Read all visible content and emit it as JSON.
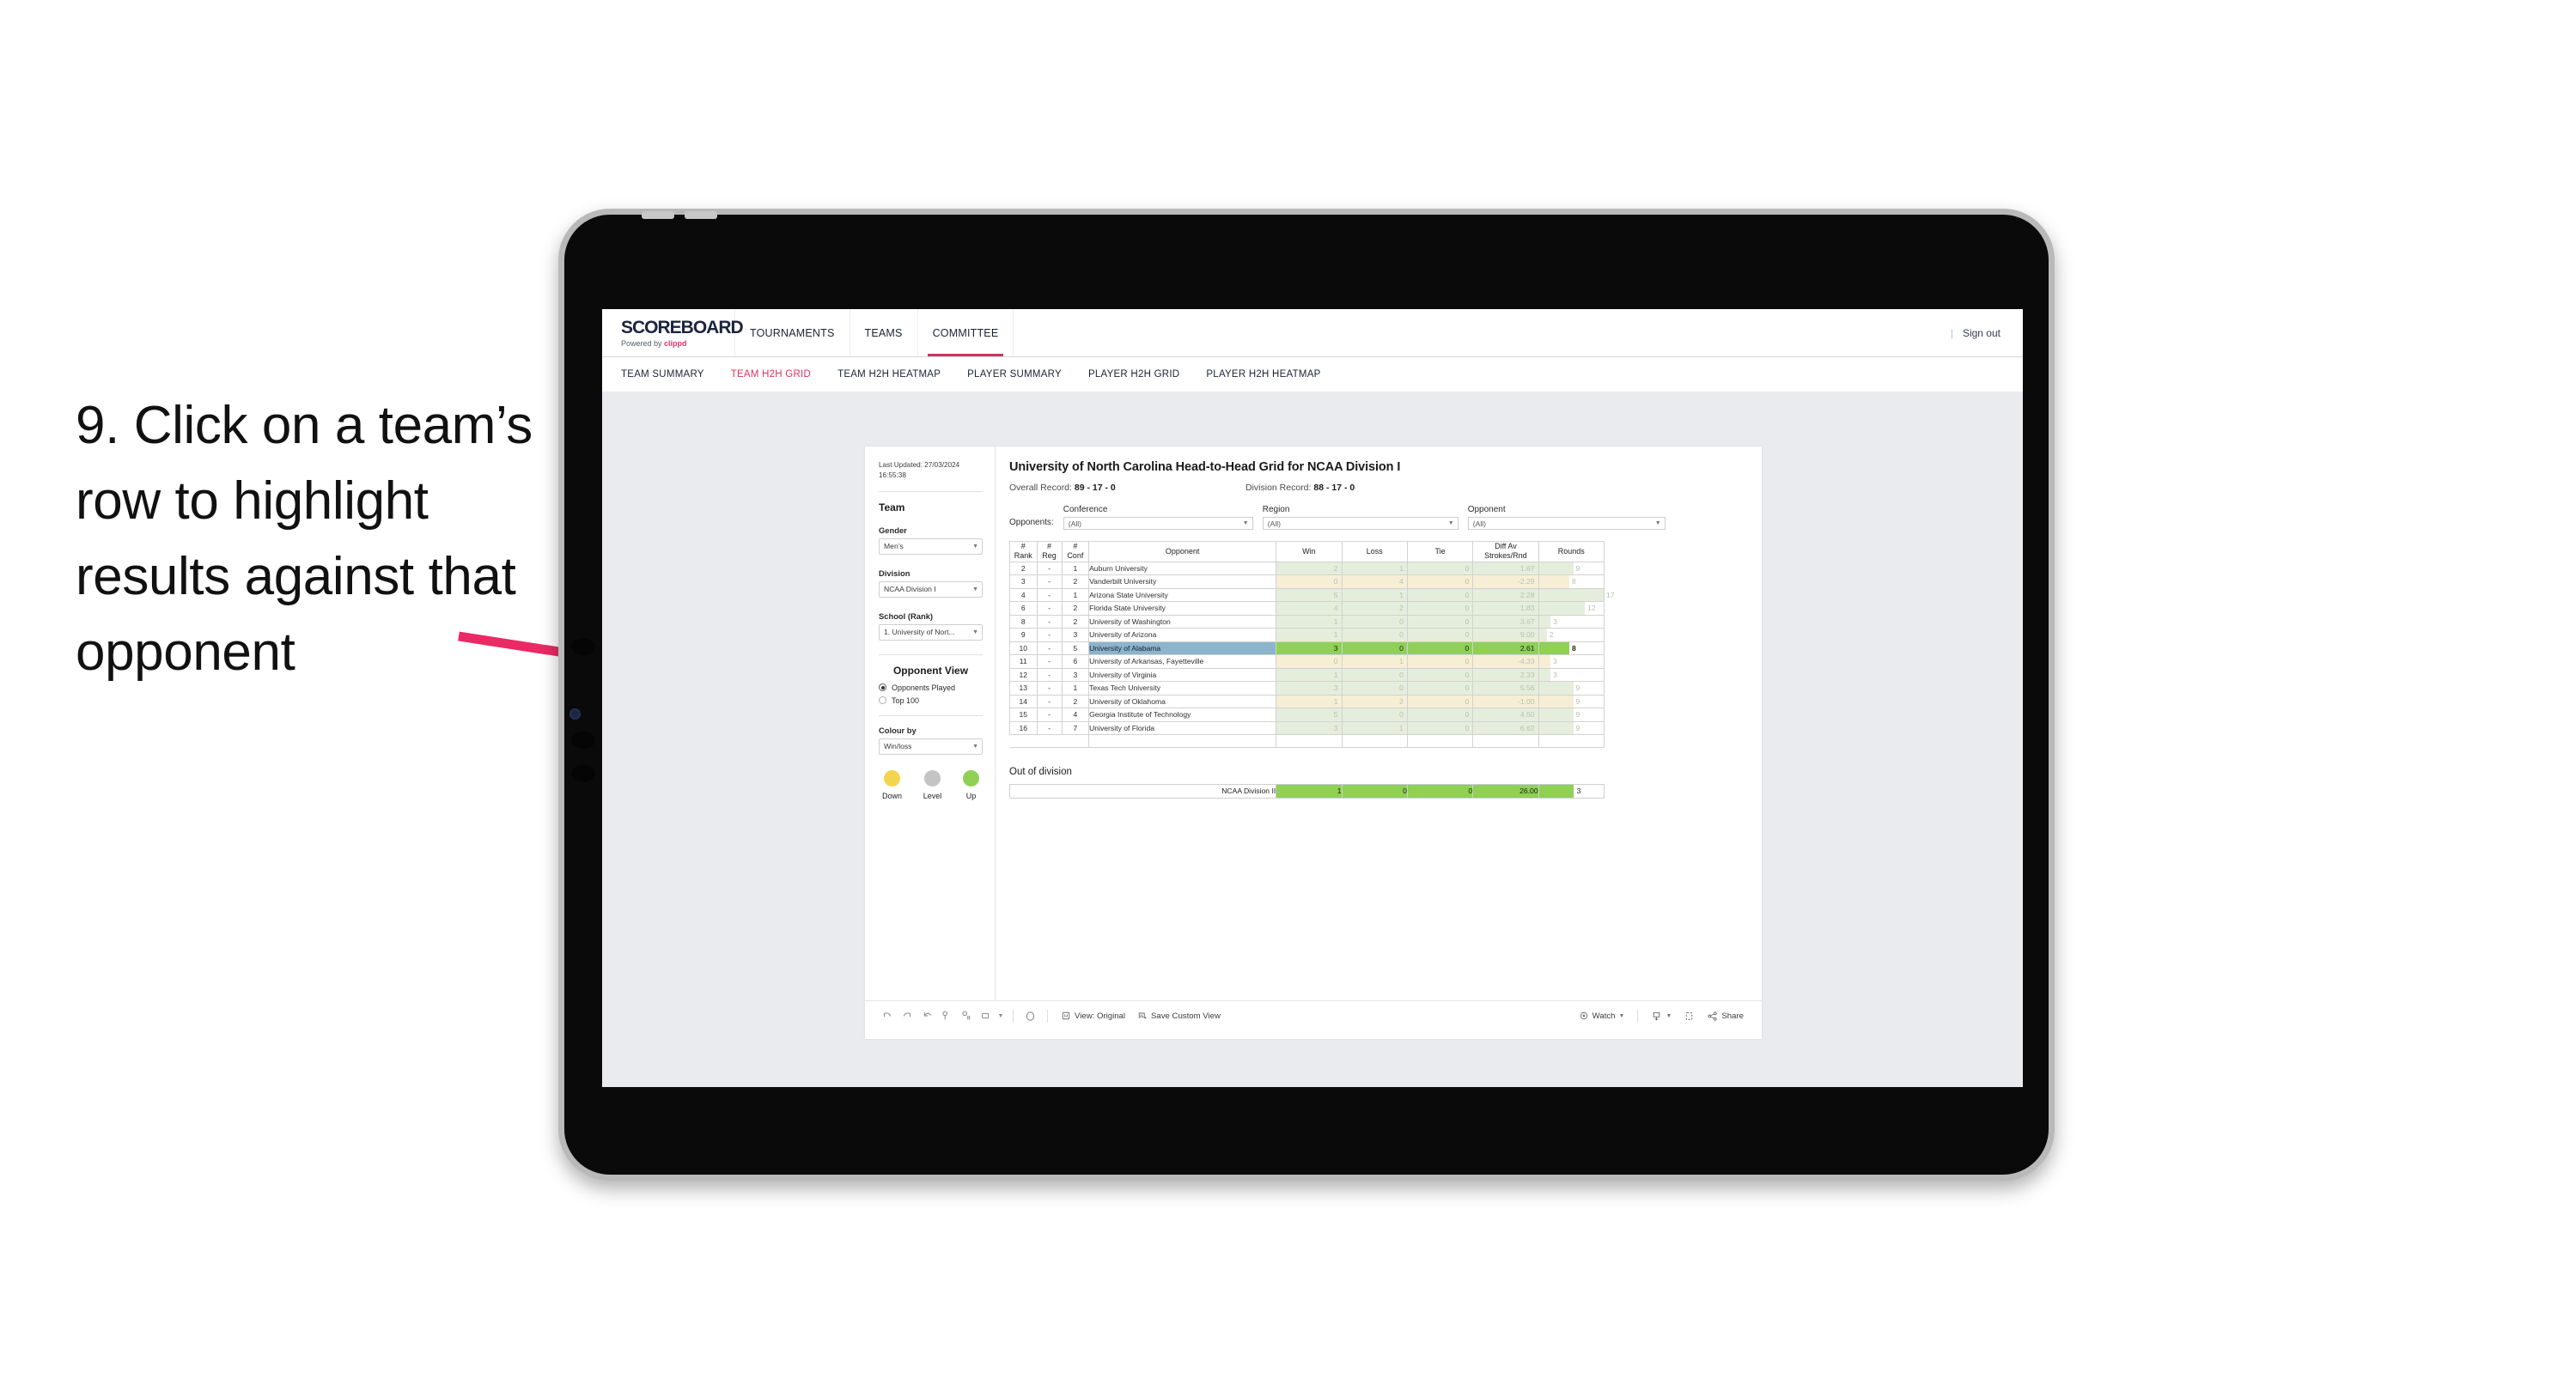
{
  "annotation": {
    "text": "9. Click on a team’s row to highlight results against that opponent",
    "arrow_color": "#ea2a64"
  },
  "topnav": {
    "logo_main": "SCOREBOARD",
    "logo_powered": "Powered by",
    "logo_brand": "clippd",
    "items": [
      {
        "label": "TOURNAMENTS",
        "active": false
      },
      {
        "label": "TEAMS",
        "active": false
      },
      {
        "label": "COMMITTEE",
        "active": true
      }
    ],
    "divider": "|",
    "signout": "Sign out",
    "active_color": "#c8355f"
  },
  "subnav": {
    "items": [
      {
        "label": "TEAM SUMMARY",
        "active": false
      },
      {
        "label": "TEAM H2H GRID",
        "active": true
      },
      {
        "label": "TEAM H2H HEATMAP",
        "active": false
      },
      {
        "label": "PLAYER SUMMARY",
        "active": false
      },
      {
        "label": "PLAYER H2H GRID",
        "active": false
      },
      {
        "label": "PLAYER H2H HEATMAP",
        "active": false
      }
    ],
    "active_color": "#e1325f"
  },
  "sidebar": {
    "last_updated_line1": "Last Updated: 27/03/2024",
    "last_updated_line2": "16:55:38",
    "team_heading": "Team",
    "gender_label": "Gender",
    "gender_value": "Men’s",
    "division_label": "Division",
    "division_value": "NCAA Division I",
    "school_label": "School (Rank)",
    "school_value": "1. University of Nort...",
    "opponent_view_heading": "Opponent View",
    "radio_options": [
      {
        "label": "Opponents Played",
        "selected": true
      },
      {
        "label": "Top 100",
        "selected": false
      }
    ],
    "colour_by_label": "Colour by",
    "colour_by_value": "Win/loss",
    "legend": [
      {
        "label": "Down",
        "color": "#f4d44e"
      },
      {
        "label": "Level",
        "color": "#c4c4c4"
      },
      {
        "label": "Up",
        "color": "#8fd055"
      }
    ]
  },
  "main": {
    "title": "University of North Carolina Head-to-Head Grid for NCAA Division I",
    "overall_record_label": "Overall Record:",
    "overall_record_value": "89 - 17 - 0",
    "division_record_label": "Division Record:",
    "division_record_value": "88 - 17 - 0",
    "opponents_label": "Opponents:",
    "filters": [
      {
        "label": "Conference",
        "value": "(All)"
      },
      {
        "label": "Region",
        "value": "(All)"
      },
      {
        "label": "Opponent",
        "value": "(All)"
      }
    ],
    "out_of_division_title": "Out of division"
  },
  "chart_data": {
    "type": "table",
    "title": "University of North Carolina Head-to-Head Grid for NCAA Division I",
    "columns": [
      "# Rank",
      "# Reg",
      "# Conf",
      "Opponent",
      "Win",
      "Loss",
      "Tie",
      "Diff Av Strokes/Rnd",
      "Rounds"
    ],
    "header_lines": [
      [
        "#",
        "Rank"
      ],
      [
        "#",
        "Reg"
      ],
      [
        "#",
        "Conf"
      ],
      [
        "",
        "Opponent"
      ],
      [
        "Win",
        ""
      ],
      [
        "Loss",
        ""
      ],
      [
        "Tie",
        ""
      ],
      [
        "Diff Av",
        "Strokes/Rnd"
      ],
      [
        "Rounds",
        ""
      ]
    ],
    "rounds_max": 17,
    "rows": [
      {
        "rank": "2",
        "reg": "-",
        "conf": "1",
        "opponent": "Auburn University",
        "win": 2,
        "loss": 1,
        "tie": 0,
        "diff": "1.67",
        "rounds": 9,
        "state": "up",
        "highlighted": false
      },
      {
        "rank": "3",
        "reg": "-",
        "conf": "2",
        "opponent": "Vanderbilt University",
        "win": 0,
        "loss": 4,
        "tie": 0,
        "diff": "-2.29",
        "rounds": 8,
        "state": "down",
        "highlighted": false
      },
      {
        "rank": "4",
        "reg": "-",
        "conf": "1",
        "opponent": "Arizona State University",
        "win": 5,
        "loss": 1,
        "tie": 0,
        "diff": "2.28",
        "rounds": 17,
        "state": "up",
        "highlighted": false
      },
      {
        "rank": "6",
        "reg": "-",
        "conf": "2",
        "opponent": "Florida State University",
        "win": 4,
        "loss": 2,
        "tie": 0,
        "diff": "1.83",
        "rounds": 12,
        "state": "up",
        "highlighted": false
      },
      {
        "rank": "8",
        "reg": "-",
        "conf": "2",
        "opponent": "University of Washington",
        "win": 1,
        "loss": 0,
        "tie": 0,
        "diff": "3.67",
        "rounds": 3,
        "state": "up",
        "highlighted": false
      },
      {
        "rank": "9",
        "reg": "-",
        "conf": "3",
        "opponent": "University of Arizona",
        "win": 1,
        "loss": 0,
        "tie": 0,
        "diff": "9.00",
        "rounds": 2,
        "state": "up",
        "highlighted": false
      },
      {
        "rank": "10",
        "reg": "-",
        "conf": "5",
        "opponent": "University of Alabama",
        "win": 3,
        "loss": 0,
        "tie": 0,
        "diff": "2.61",
        "rounds": 8,
        "state": "up",
        "highlighted": true
      },
      {
        "rank": "11",
        "reg": "-",
        "conf": "6",
        "opponent": "University of Arkansas, Fayetteville",
        "win": 0,
        "loss": 1,
        "tie": 0,
        "diff": "-4.33",
        "rounds": 3,
        "state": "down",
        "highlighted": false
      },
      {
        "rank": "12",
        "reg": "-",
        "conf": "3",
        "opponent": "University of Virginia",
        "win": 1,
        "loss": 0,
        "tie": 0,
        "diff": "2.33",
        "rounds": 3,
        "state": "up",
        "highlighted": false
      },
      {
        "rank": "13",
        "reg": "-",
        "conf": "1",
        "opponent": "Texas Tech University",
        "win": 3,
        "loss": 0,
        "tie": 0,
        "diff": "5.56",
        "rounds": 9,
        "state": "up",
        "highlighted": false
      },
      {
        "rank": "14",
        "reg": "-",
        "conf": "2",
        "opponent": "University of Oklahoma",
        "win": 1,
        "loss": 2,
        "tie": 0,
        "diff": "-1.00",
        "rounds": 9,
        "state": "down",
        "highlighted": false
      },
      {
        "rank": "15",
        "reg": "-",
        "conf": "4",
        "opponent": "Georgia Institute of Technology",
        "win": 5,
        "loss": 0,
        "tie": 0,
        "diff": "4.50",
        "rounds": 9,
        "state": "up",
        "highlighted": false
      },
      {
        "rank": "16",
        "reg": "-",
        "conf": "7",
        "opponent": "University of Florida",
        "win": 3,
        "loss": 1,
        "tie": 0,
        "diff": "6.62",
        "rounds": 9,
        "state": "up",
        "highlighted": false
      }
    ],
    "out_of_division": {
      "name": "NCAA Division II",
      "win": "1",
      "loss": "0",
      "tie": "0",
      "diff": "26.00",
      "rounds": "3"
    },
    "colors": {
      "up_fill": "#e5eedc",
      "down_fill": "#f7eed6",
      "highlight_green": "#8fd055",
      "highlight_blue": "#8cb4cc",
      "rounds_up": "#e5eedc",
      "rounds_down": "#f7eed6"
    }
  },
  "toolbar": {
    "icons": [
      "undo-icon",
      "redo-icon",
      "revert-icon",
      "refresh-icon",
      "pause-icon",
      "zoom-icon"
    ],
    "alerts_icon": "alerts-icon",
    "view_label": "View: Original",
    "save_custom_view_label": "Save Custom View",
    "watch_label": "Watch",
    "download_icon": "download-icon",
    "fullscreen_icon": "fullscreen-icon",
    "share_label": "Share"
  }
}
